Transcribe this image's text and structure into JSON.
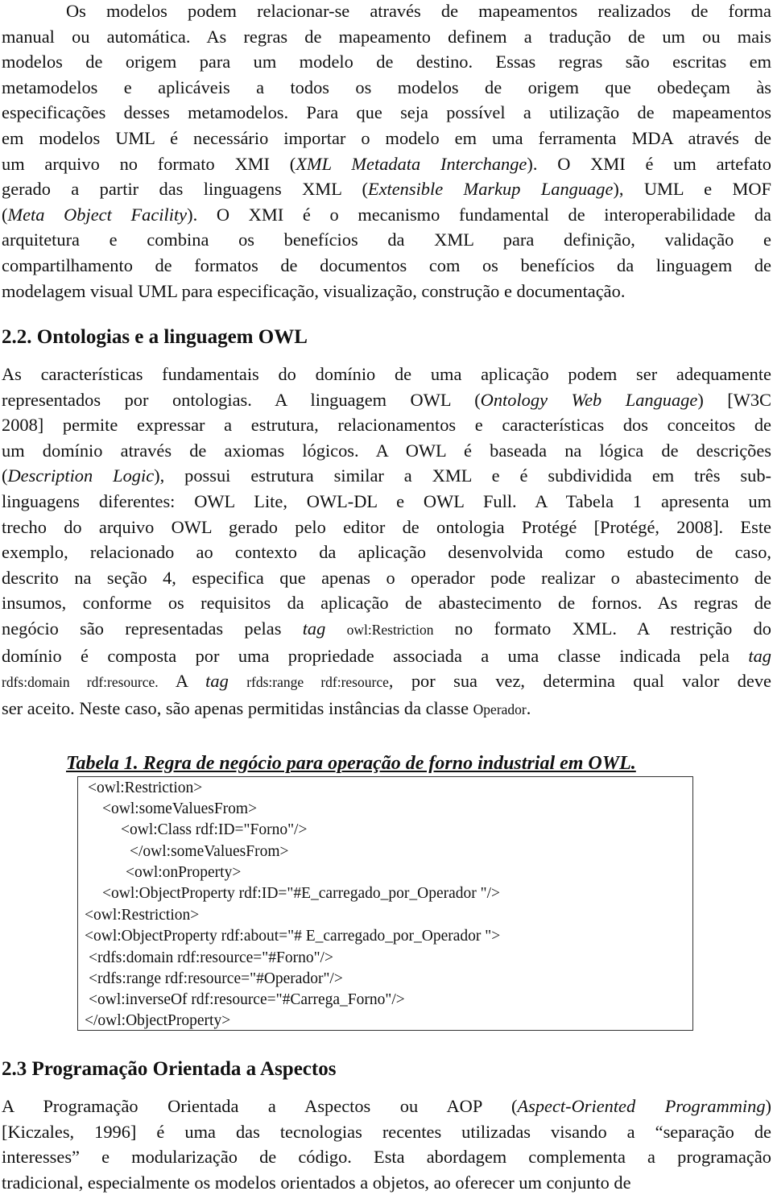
{
  "paragraph1": {
    "lines": [
      "Os modelos podem relacionar-se através de mapeamentos realizados de forma",
      "manual ou automática. As regras de mapeamento definem a tradução de um ou mais",
      "modelos de origem para um modelo de destino. Essas regras são escritas em",
      "metamodelos e aplicáveis a todos os modelos de origem que obedeçam às",
      "especificações desses metamodelos. Para que seja possível a utilização de mapeamentos",
      "em modelos UML é necessário importar o modelo em uma ferramenta MDA através de",
      [
        "um arquivo no formato XMI (",
        {
          "i": "XML Metadata Interchange"
        },
        "). O XMI é um artefato"
      ],
      [
        "gerado a partir das linguagens XML (",
        {
          "i": "Extensible Markup Language"
        },
        "), UML e MOF"
      ],
      [
        "(",
        {
          "i": "Meta Object Facility"
        },
        "). O XMI é o mecanismo fundamental de interoperabilidade da"
      ],
      "arquitetura e combina os benefícios da XML para definição, validação e",
      "compartilhamento de formatos de documentos com os benefícios da linguagem de",
      "modelagem visual UML para especificação, visualização, construção e documentação."
    ]
  },
  "section_2_2": {
    "heading": "2.2. Ontologias e a linguagem OWL",
    "lines": [
      "As características fundamentais do domínio de uma aplicação podem ser adequamente",
      [
        "representados por ontologias. A linguagem OWL (",
        {
          "i": "Ontology Web Language"
        },
        ") [W3C"
      ],
      "2008] permite expressar a estrutura, relacionamentos e características dos conceitos de",
      "um domínio através de axiomas lógicos. A OWL é baseada na lógica de descrições",
      [
        "(",
        {
          "i": "Description Logic"
        },
        "), possui estrutura similar a XML e é subdividida em três sub-"
      ],
      "linguagens diferentes: OWL Lite, OWL-DL e OWL Full. A Tabela 1 apresenta um",
      "trecho do arquivo OWL gerado pelo editor de ontologia Protégé [Protégé, 2008]. Este",
      "exemplo, relacionado ao contexto da aplicação desenvolvida como estudo de caso,",
      "descrito na seção 4, especifica que apenas o operador pode realizar o abastecimento de",
      "insumos, conforme os requisitos da aplicação de abastecimento de fornos. As regras de",
      [
        "negócio são representadas pelas ",
        {
          "i": "tag"
        },
        " ",
        {
          "s": "owl:Restriction"
        },
        " no formato XML. A restrição do"
      ],
      [
        "domínio é composta por uma propriedade associada a uma classe indicada pela ",
        {
          "i": "tag"
        }
      ],
      [
        {
          "s": "rdfs:domain rdf:resource."
        },
        " A ",
        {
          "i": "tag"
        },
        "  ",
        {
          "s": "rfds:range rdf:resource"
        },
        ", por sua vez, determina qual valor deve"
      ],
      [
        "ser aceito. Neste caso, são apenas permitidas instâncias da classe ",
        {
          "s": "Operador"
        },
        "."
      ]
    ]
  },
  "table1": {
    "caption": "Tabela 1. Regra de negócio para operação de forno industrial em OWL.",
    "code_lines": [
      "<owl:Restriction>",
      "<owl:someValuesFrom>",
      "<owl:Class rdf:ID=\"Forno\"/>",
      "</owl:someValuesFrom>",
      "<owl:onProperty>",
      "<owl:ObjectProperty rdf:ID=\"#E_carregado_por_Operador \"/>",
      "<owl:Restriction>",
      "<owl:ObjectProperty rdf:about=\"# E_carregado_por_Operador \">",
      "<rdfs:domain rdf:resource=\"#Forno\"/>",
      "<rdfs:range rdf:resource=\"#Operador\"/>",
      "<owl:inverseOf rdf:resource=\"#Carrega_Forno\"/>",
      "</owl:ObjectProperty>"
    ]
  },
  "section_2_3": {
    "heading": "2.3 Programação Orientada a Aspectos",
    "lines": [
      [
        "A Programação Orientada a Aspectos ou AOP (",
        {
          "i": "Aspect-Oriented Programming"
        },
        ")"
      ],
      "[Kiczales, 1996] é uma das tecnologias recentes utilizadas visando a “separação de",
      "interesses” e modularização de código. Esta abordagem complementa a programação",
      "tradicional, especialmente os modelos orientados a objetos, ao oferecer um conjunto de"
    ]
  }
}
